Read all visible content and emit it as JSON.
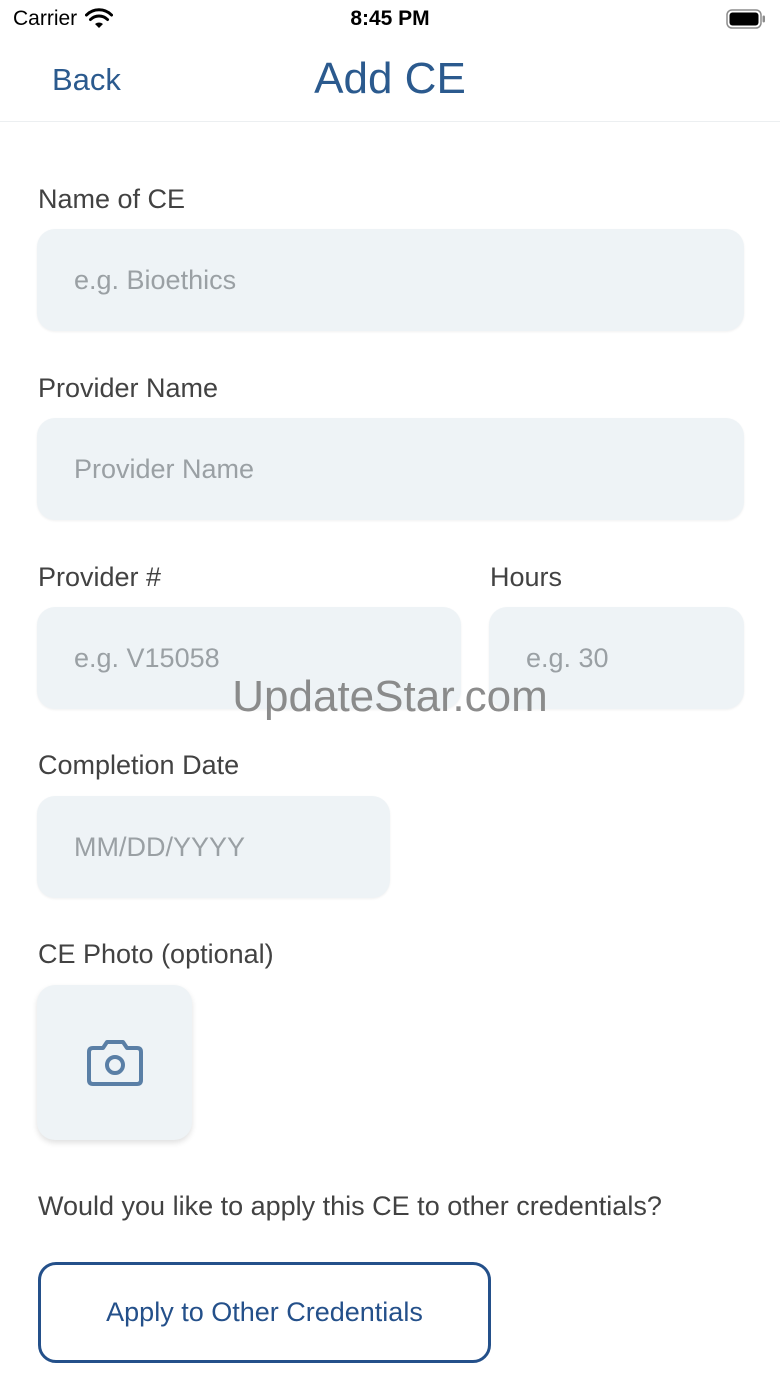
{
  "status_bar": {
    "carrier": "Carrier",
    "time": "8:45 PM"
  },
  "nav": {
    "back_label": "Back",
    "title": "Add CE"
  },
  "form": {
    "name_label": "Name of CE",
    "name_placeholder": "e.g. Bioethics",
    "provider_name_label": "Provider Name",
    "provider_name_placeholder": "Provider Name",
    "provider_number_label": "Provider #",
    "provider_number_placeholder": "e.g. V15058",
    "hours_label": "Hours",
    "hours_placeholder": "e.g. 30",
    "completion_date_label": "Completion Date",
    "completion_date_placeholder": "MM/DD/YYYY",
    "photo_label": "CE Photo (optional)",
    "photo_icon": "camera-icon",
    "apply_question": "Would you like to apply this CE to other credentials?",
    "apply_button_label": "Apply to Other Credentials"
  },
  "watermark": "UpdateStar.com",
  "colors": {
    "accent": "#2b5a8e",
    "field_bg": "#eef3f6",
    "button_border": "#24508a"
  }
}
